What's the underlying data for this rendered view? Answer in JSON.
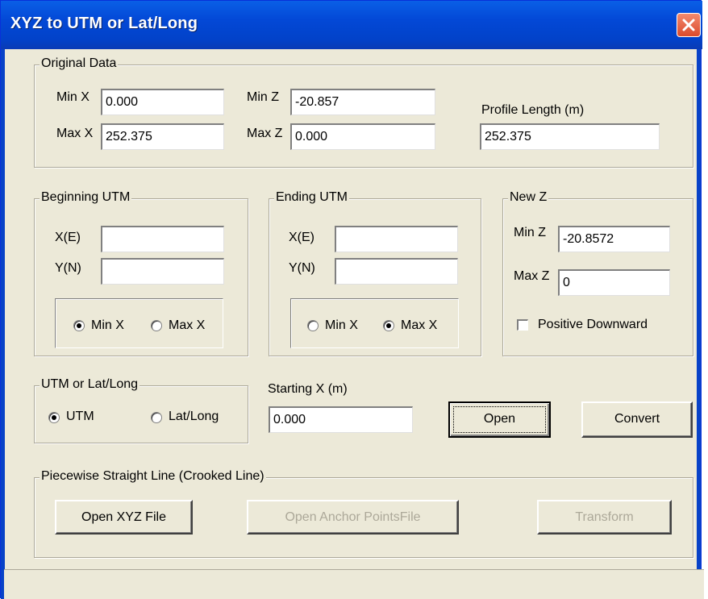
{
  "window": {
    "title": "XYZ to UTM or Lat/Long"
  },
  "original_data": {
    "legend": "Original Data",
    "min_x_label": "Min X",
    "min_x_value": "0.000",
    "max_x_label": "Max X",
    "max_x_value": "252.375",
    "min_z_label": "Min Z",
    "min_z_value": "-20.857",
    "max_z_label": "Max Z",
    "max_z_value": "0.000",
    "profile_length_label": "Profile Length (m)",
    "profile_length_value": "252.375"
  },
  "beginning_utm": {
    "legend": "Beginning UTM",
    "x_label": "X(E)",
    "x_value": "",
    "y_label": "Y(N)",
    "y_value": "",
    "radio_min_label": "Min X",
    "radio_max_label": "Max X",
    "selected": "Min X"
  },
  "ending_utm": {
    "legend": "Ending UTM",
    "x_label": "X(E)",
    "x_value": "",
    "y_label": "Y(N)",
    "y_value": "",
    "radio_min_label": "Min X",
    "radio_max_label": "Max X",
    "selected": "Max X"
  },
  "new_z": {
    "legend": "New Z",
    "min_z_label": "Min Z",
    "min_z_value": "-20.8572",
    "max_z_label": "Max Z",
    "max_z_value": "0",
    "positive_downward_label": "Positive Downward",
    "positive_downward_checked": false
  },
  "utm_latlong": {
    "legend": "UTM or Lat/Long",
    "utm_label": "UTM",
    "latlong_label": "Lat/Long",
    "selected": "UTM"
  },
  "starting_x": {
    "label": "Starting X (m)",
    "value": "0.000"
  },
  "buttons": {
    "open": "Open",
    "convert": "Convert"
  },
  "piecewise": {
    "legend": "Piecewise Straight Line (Crooked Line)",
    "open_xyz": "Open XYZ File",
    "open_anchor": "Open Anchor PointsFile",
    "transform": "Transform"
  }
}
